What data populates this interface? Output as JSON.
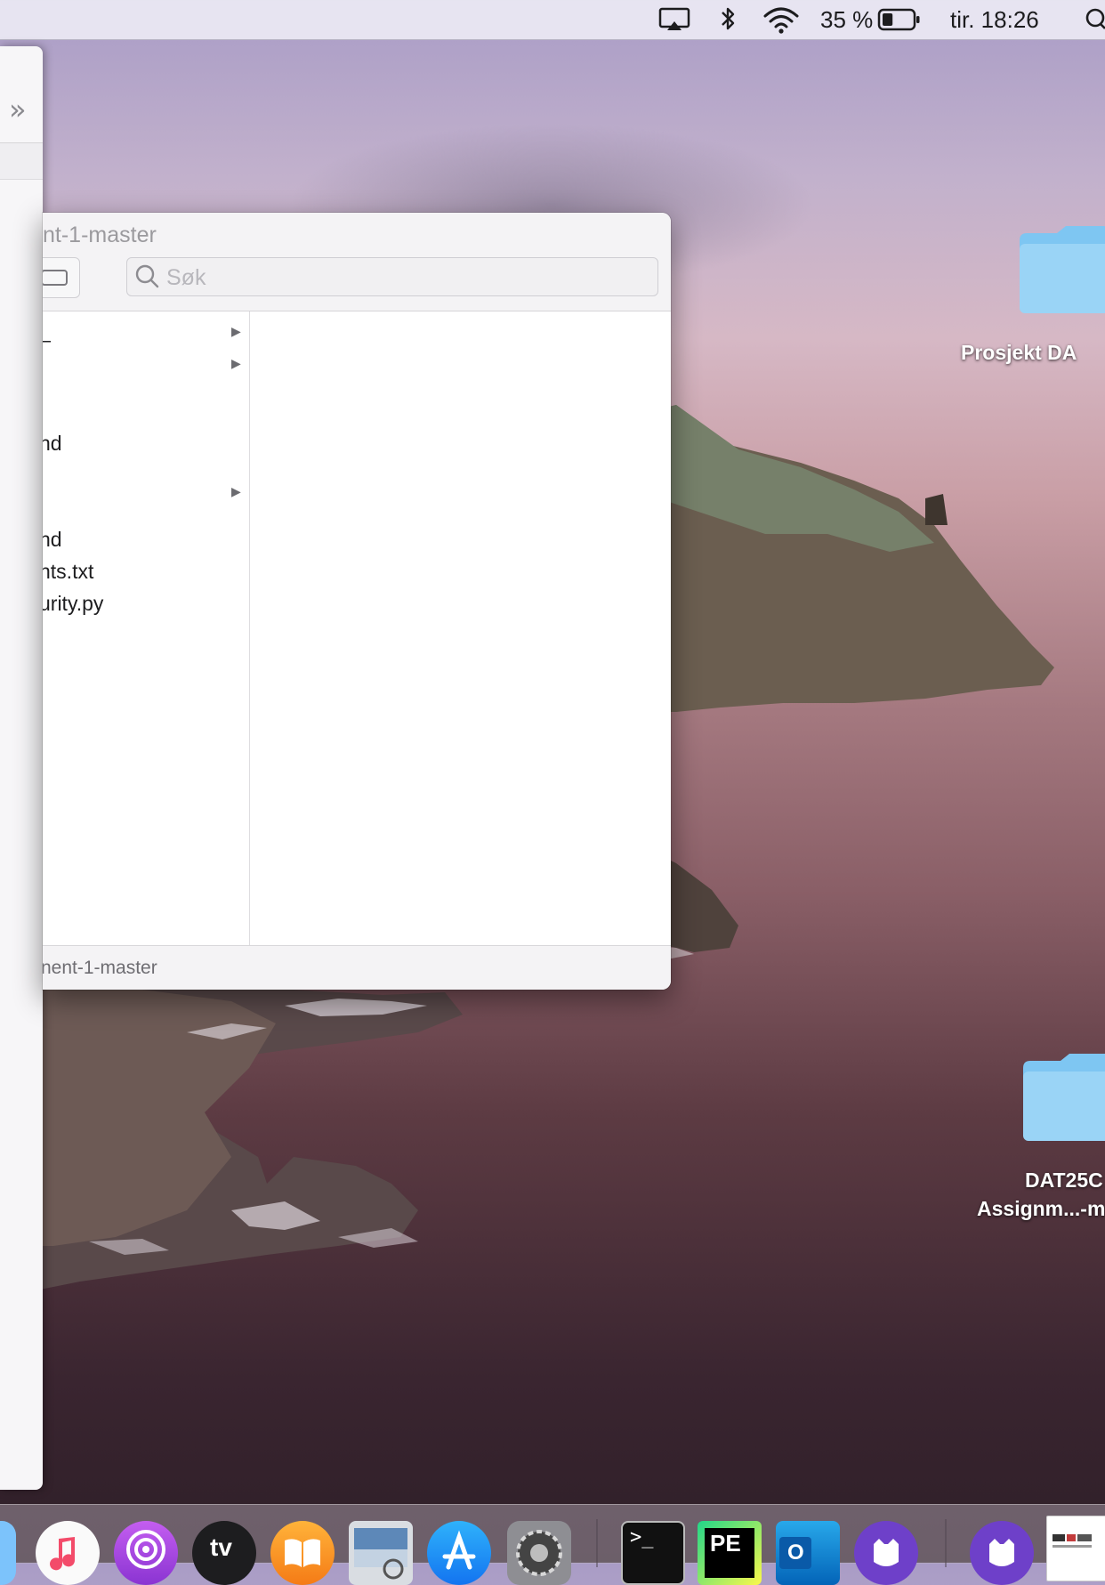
{
  "menubar": {
    "battery_percent": "35 %",
    "battery_level": 0.35,
    "clock": "tir. 18:26",
    "status_icons": [
      "airplay-icon",
      "bluetooth-icon",
      "wifi-icon",
      "battery-icon",
      "spotlight-icon"
    ]
  },
  "desktop": {
    "icons": [
      {
        "name": "folder-icon",
        "label": "Prosjekt DA"
      },
      {
        "name": "folder-icon",
        "label_line1": "DAT25C",
        "label_line2": "Assignm...-m"
      }
    ]
  },
  "sidepanel": {
    "overflow_icon": "chevron-double-right-icon",
    "overflow_glyph": "»"
  },
  "finder": {
    "title": "nt-1-master",
    "search_placeholder": "Søk",
    "items": [
      {
        "label": "_",
        "has_children": true
      },
      {
        "label": "",
        "has_children": true
      },
      {
        "label": "nd",
        "has_children": false
      },
      {
        "label": "",
        "has_children": true
      },
      {
        "label": "nd",
        "has_children": false
      },
      {
        "label": "nts.txt",
        "has_children": false
      },
      {
        "label": "urity.py",
        "has_children": false
      }
    ],
    "path_label": "nent-1-master"
  },
  "dock": {
    "apps": [
      "finder-icon",
      "music-icon",
      "podcasts-icon",
      "apple-tv-icon",
      "books-icon",
      "preview-icon",
      "app-store-icon",
      "system-preferences-icon",
      "terminal-icon",
      "pycharm-edu-icon",
      "outlook-icon",
      "github-desktop-icon",
      "github-desktop-icon",
      "document-thumbnail-icon"
    ],
    "tv_label": "tv",
    "terminal_prompt": ">_",
    "pycharm_label": "PE",
    "outlook_label": "O"
  },
  "colors": {
    "folder_blue": "#7ec6f2",
    "finder_bg": "#ffffff",
    "toolbar_bg": "#f4f3f5",
    "menubar_bg": "#eceaf4"
  }
}
